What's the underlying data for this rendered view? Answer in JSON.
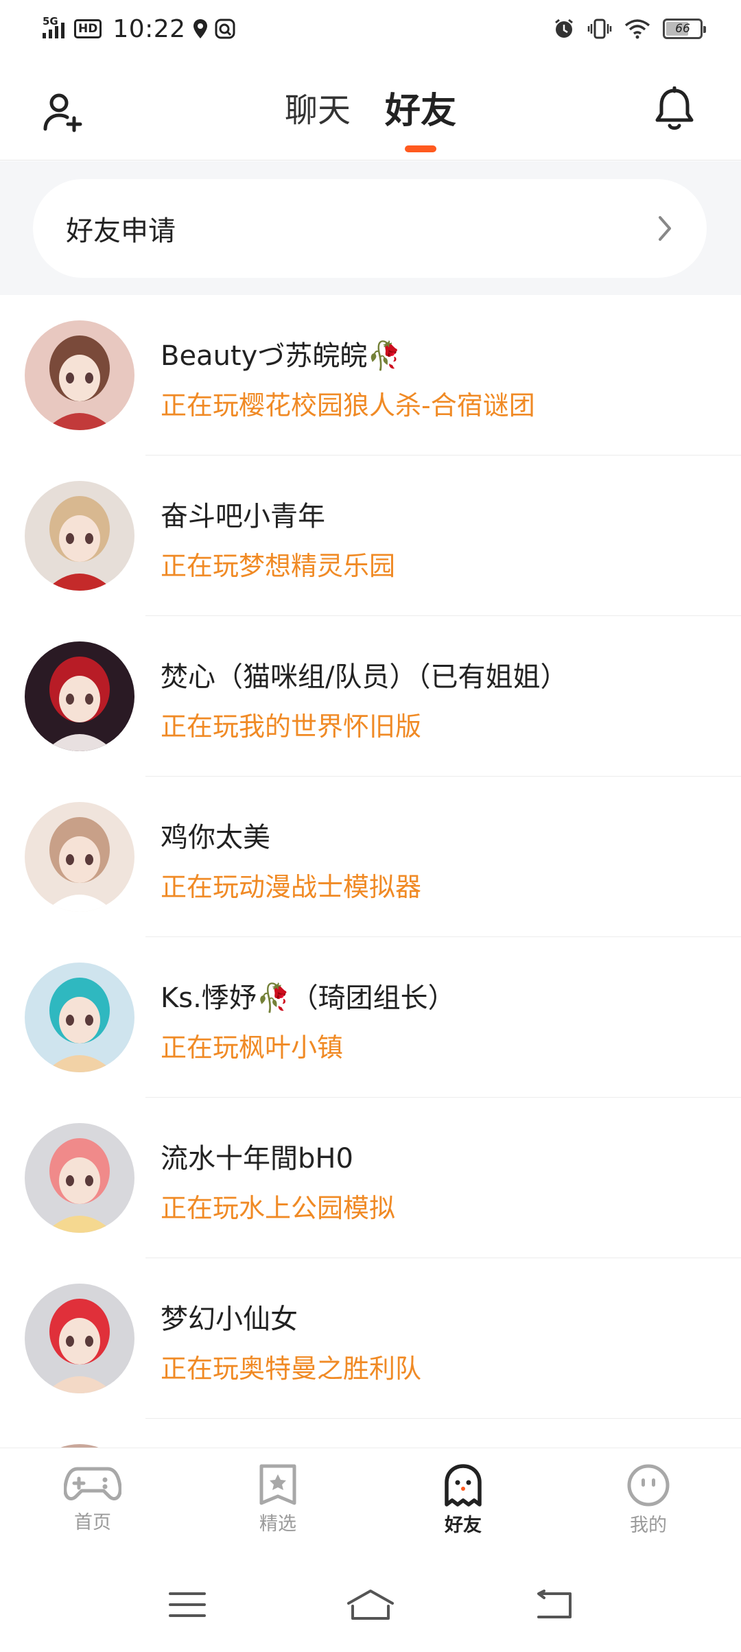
{
  "status_bar": {
    "network": "5G",
    "hd": "HD",
    "time": "10:22",
    "battery": "66",
    "battery_level": 0.66
  },
  "header": {
    "tabs": [
      {
        "label": "聊天",
        "active": false
      },
      {
        "label": "好友",
        "active": true
      }
    ],
    "left_icon": "add-user-icon",
    "right_icon": "bell-icon"
  },
  "friend_request": {
    "label": "好友申请",
    "icon": "chevron-right-icon"
  },
  "friends": [
    {
      "name": "Beautyづ苏皖皖🥀",
      "status": "正在玩樱花校园狼人杀-合宿谜团",
      "avatar_colors": [
        "#e8c8c0",
        "#7a4a3a",
        "#c23a3a"
      ]
    },
    {
      "name": "奋斗吧小青年",
      "status": "正在玩梦想精灵乐园",
      "avatar_colors": [
        "#e6ded8",
        "#d8b890",
        "#c42a2a"
      ]
    },
    {
      "name": "焚心（猫咪组/队员）（已有姐姐）",
      "status": "正在玩我的世界怀旧版",
      "avatar_colors": [
        "#2a1a24",
        "#b81c26",
        "#e8e0e0"
      ]
    },
    {
      "name": "鸡你太美",
      "status": "正在玩动漫战士模拟器",
      "avatar_colors": [
        "#f0e4dc",
        "#c8a088",
        "#ffffff"
      ]
    },
    {
      "name": "Ks.悸妤🥀（琦团组长）",
      "status": "正在玩枫叶小镇",
      "avatar_colors": [
        "#cfe4ee",
        "#2fb8c0",
        "#f2d2a6"
      ]
    },
    {
      "name": "流水十年間bH0",
      "status": "正在玩水上公园模拟",
      "avatar_colors": [
        "#d8d8dc",
        "#f08a8a",
        "#f5d890"
      ]
    },
    {
      "name": "梦幻小仙女",
      "status": "正在玩奥特曼之胜利队",
      "avatar_colors": [
        "#d6d6da",
        "#e0303a",
        "#f3d9c6"
      ]
    }
  ],
  "bottom_nav": [
    {
      "label": "首页",
      "icon": "gamepad-icon",
      "active": false
    },
    {
      "label": "精选",
      "icon": "star-bookmark-icon",
      "active": false
    },
    {
      "label": "好友",
      "icon": "ghost-icon",
      "active": true
    },
    {
      "label": "我的",
      "icon": "face-icon",
      "active": false
    }
  ],
  "system_nav": [
    "menu-icon",
    "home-icon",
    "back-icon"
  ]
}
